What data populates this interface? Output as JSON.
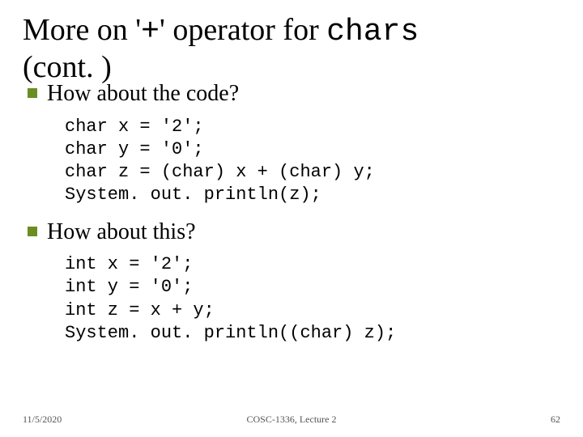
{
  "title": {
    "pre": "More on '",
    "plus": "+",
    "mid": "' operator for ",
    "chars": "chars",
    "cont": "(cont. )"
  },
  "bullets": {
    "b1": "How about the code?",
    "b2": "How about this?"
  },
  "code1": "char x = '2';\nchar y = '0';\nchar z = (char) x + (char) y;\nSystem. out. println(z);",
  "code2": "int x = '2';\nint y = '0';\nint z = x + y;\nSystem. out. println((char) z);",
  "footer": {
    "date": "11/5/2020",
    "center": "COSC-1336, Lecture 2",
    "page": "62"
  }
}
